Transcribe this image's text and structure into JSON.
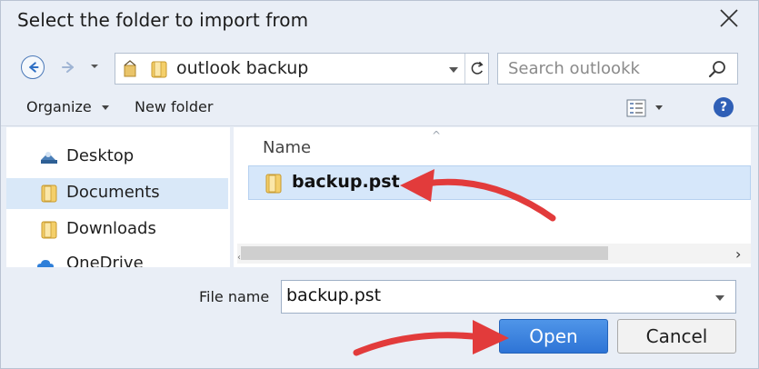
{
  "dialog": {
    "title": "Select the folder to import from",
    "close_icon": "close-icon"
  },
  "address": {
    "path": "outlook backup",
    "search_placeholder": "Search outlookk"
  },
  "toolbar": {
    "organize_label": "Organize",
    "new_folder_label": "New folder"
  },
  "nav": {
    "items": [
      {
        "label": "Desktop",
        "icon": "desktop-icon",
        "selected": false
      },
      {
        "label": "Documents",
        "icon": "folder-icon",
        "selected": true
      },
      {
        "label": "Downloads",
        "icon": "folder-icon",
        "selected": false
      },
      {
        "label": "OneDrive",
        "icon": "cloud-icon",
        "selected": false
      }
    ]
  },
  "files": {
    "column_name": "Name",
    "rows": [
      {
        "name": "backup.pst",
        "icon": "folder-icon",
        "selected": true
      }
    ]
  },
  "footer": {
    "file_name_label": "File name",
    "file_name_value": "backup.pst",
    "open_label": "Open",
    "cancel_label": "Cancel"
  },
  "colors": {
    "accent": "#2e74d6",
    "selection": "#d6e7fa",
    "annotation_arrow": "#e23b3b"
  }
}
